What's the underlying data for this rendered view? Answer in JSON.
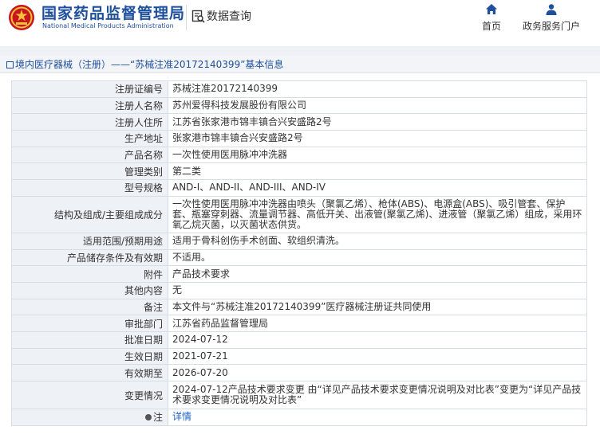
{
  "header": {
    "brand_cn": "国家药品监督管理局",
    "brand_en": "National Medical Products Administration",
    "query_label": "数据查询",
    "nav": {
      "home": "首页",
      "service": "政务服务门户"
    }
  },
  "breadcrumb": "境内医疗器械（注册）——“苏械注准20172140399”基本信息",
  "colors": {
    "brand_blue": "#1e4f9c",
    "label_bg": "#eef2f7",
    "border": "#d7dde5",
    "link": "#1e64c8",
    "logo_red": "#c8161d"
  },
  "icons": {
    "logo": "national-emblem",
    "query": "search-doc-icon",
    "home": "home-icon",
    "service": "user-icon",
    "note": "pin-icon"
  },
  "rows": [
    {
      "label": "注册证编号",
      "value": "苏械注准20172140399"
    },
    {
      "label": "注册人名称",
      "value": "苏州爱得科技发展股份有限公司"
    },
    {
      "label": "注册人住所",
      "value": "江苏省张家港市锦丰镇合兴安盛路2号"
    },
    {
      "label": "生产地址",
      "value": "张家港市锦丰镇合兴安盛路2号"
    },
    {
      "label": "产品名称",
      "value": "一次性使用医用脉冲冲洗器"
    },
    {
      "label": "管理类别",
      "value": "第二类"
    },
    {
      "label": "型号规格",
      "value": "AND-I、AND-II、AND-III、AND-IV"
    },
    {
      "label": "结构及组成/主要组成成分",
      "value": "一次性使用医用脉冲冲洗器由喷头（聚氯乙烯）、枪体(ABS)、电源盒(ABS)、吸引管套、保护套、瓶塞穿刺器、流量调节器、高低开关、出液管(聚氯乙烯)、进液管（聚氯乙烯）组成，采用环氧乙烷灭菌，以灭菌状态供货。"
    },
    {
      "label": "适用范围/预期用途",
      "value": "适用于骨科创伤手术创面、软组织清洗。"
    },
    {
      "label": "产品储存条件及有效期",
      "value": "不适用。"
    },
    {
      "label": "附件",
      "value": "产品技术要求"
    },
    {
      "label": "其他内容",
      "value": "无"
    },
    {
      "label": "备注",
      "value": "本文件与“苏械注准20172140399”医疗器械注册证共同使用"
    },
    {
      "label": "审批部门",
      "value": "江苏省药品监督管理局"
    },
    {
      "label": "批准日期",
      "value": "2024-07-12"
    },
    {
      "label": "生效日期",
      "value": "2021-07-21"
    },
    {
      "label": "有效期至",
      "value": "2026-07-20"
    },
    {
      "label": "变更情况",
      "value": "2024-07-12产品技术要求变更 由“详见产品技术要求变更情况说明及对比表”变更为“详见产品技术要求变更情况说明及对比表”"
    },
    {
      "label": "注",
      "value": "详情"
    }
  ]
}
